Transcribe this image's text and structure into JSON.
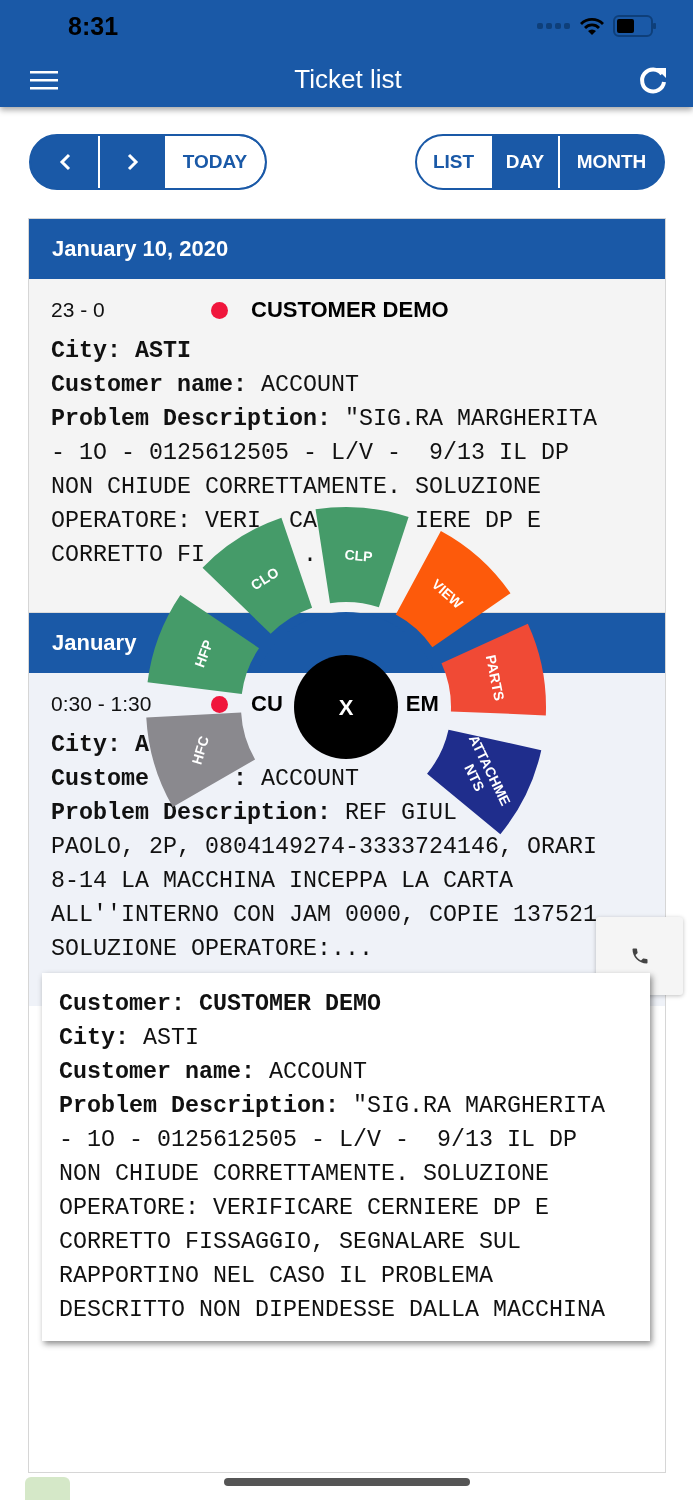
{
  "status_bar": {
    "time": "8:31"
  },
  "header": {
    "title": "Ticket list"
  },
  "nav_buttons": {
    "today": "TODAY"
  },
  "view_tabs": [
    {
      "label": "LIST",
      "selected": true
    },
    {
      "label": "DAY",
      "selected": false
    },
    {
      "label": "MONTH",
      "selected": false
    }
  ],
  "groups": [
    {
      "date": "January 10, 2020",
      "tickets": [
        {
          "time": "23 - 0",
          "color": "#f0163c",
          "customer_parts": [
            "CUSTOMER DEMO"
          ],
          "city_label": "City:",
          "city": "ASTI",
          "name_label": "Customer name:",
          "name": "ACCOUNT",
          "description_label": "Problem Description:",
          "description_lines": [
            [
              "\"SIG.RA MARGHERITA"
            ],
            [
              "- 1O - 0125612505 - L/V -  9/13 IL DP"
            ],
            [
              "NON CHIUDE CORRETTAMENTE. SOLUZIONE"
            ],
            [
              "OPERATORE: VERI",
              "  CA",
              "       IERE DP E"
            ],
            [
              "CORRETTO FI",
              "       ."
            ]
          ]
        }
      ]
    },
    {
      "date": "January",
      "tickets": [
        {
          "time": "0:30 - 1:30",
          "color": "#f0163c",
          "customer_parts": [
            "CU",
            "EM"
          ],
          "city_label": "City:",
          "city": "A",
          "name_label": "Custome      :",
          "name": "ACCOUNT",
          "description_label": "Problem Description:",
          "description_lines": [
            [
              "REF GIUL"
            ],
            [
              "PAOLO, 2P, 0804149274-3333724146, ORARI"
            ],
            [
              "8-14 LA MACCHINA INCEPPA LA CARTA"
            ],
            [
              "ALL''INTERNO CON JAM 0000, COPIE 137521"
            ],
            [
              "SOLUZIONE OPERATORE:..."
            ]
          ]
        }
      ]
    }
  ],
  "action_menu": {
    "close_label": "X",
    "items": [
      {
        "lines": [
          "HFC"
        ],
        "color": "#8a898e"
      },
      {
        "lines": [
          "HFP"
        ],
        "color": "#459b69"
      },
      {
        "lines": [
          "CLO"
        ],
        "color": "#459b69"
      },
      {
        "lines": [
          "CLP"
        ],
        "color": "#459b69"
      },
      {
        "lines": [
          "VIEW"
        ],
        "color": "#fd5a0b"
      },
      {
        "lines": [
          "PARTS"
        ],
        "color": "#f04a35"
      },
      {
        "lines": [
          "ATTACHME",
          "NTS"
        ],
        "color": "#1f2d8c"
      }
    ]
  },
  "popup": {
    "customer_label": "Customer:",
    "customer": "CUSTOMER DEMO",
    "city_label": "City:",
    "city": "ASTI",
    "name_label": "Customer name:",
    "name": "ACCOUNT",
    "description_label": "Problem Description:",
    "description_lines": [
      [
        "\"SIG.RA MARGHERITA"
      ],
      [
        "- 1O - 0125612505 - L/V -  9/13 IL DP"
      ],
      [
        "NON CHIUDE CORRETTAMENTE. SOLUZIONE"
      ],
      [
        "OPERATORE: VERIFICARE CERNIERE DP E"
      ],
      [
        "CORRETTO FISSAGGIO, SEGNALARE SUL"
      ],
      [
        "RAPPORTINO NEL CASO IL PROBLEMA"
      ],
      [
        "DESCRITTO NON DIPENDESSE DALLA MACCHINA"
      ]
    ]
  }
}
